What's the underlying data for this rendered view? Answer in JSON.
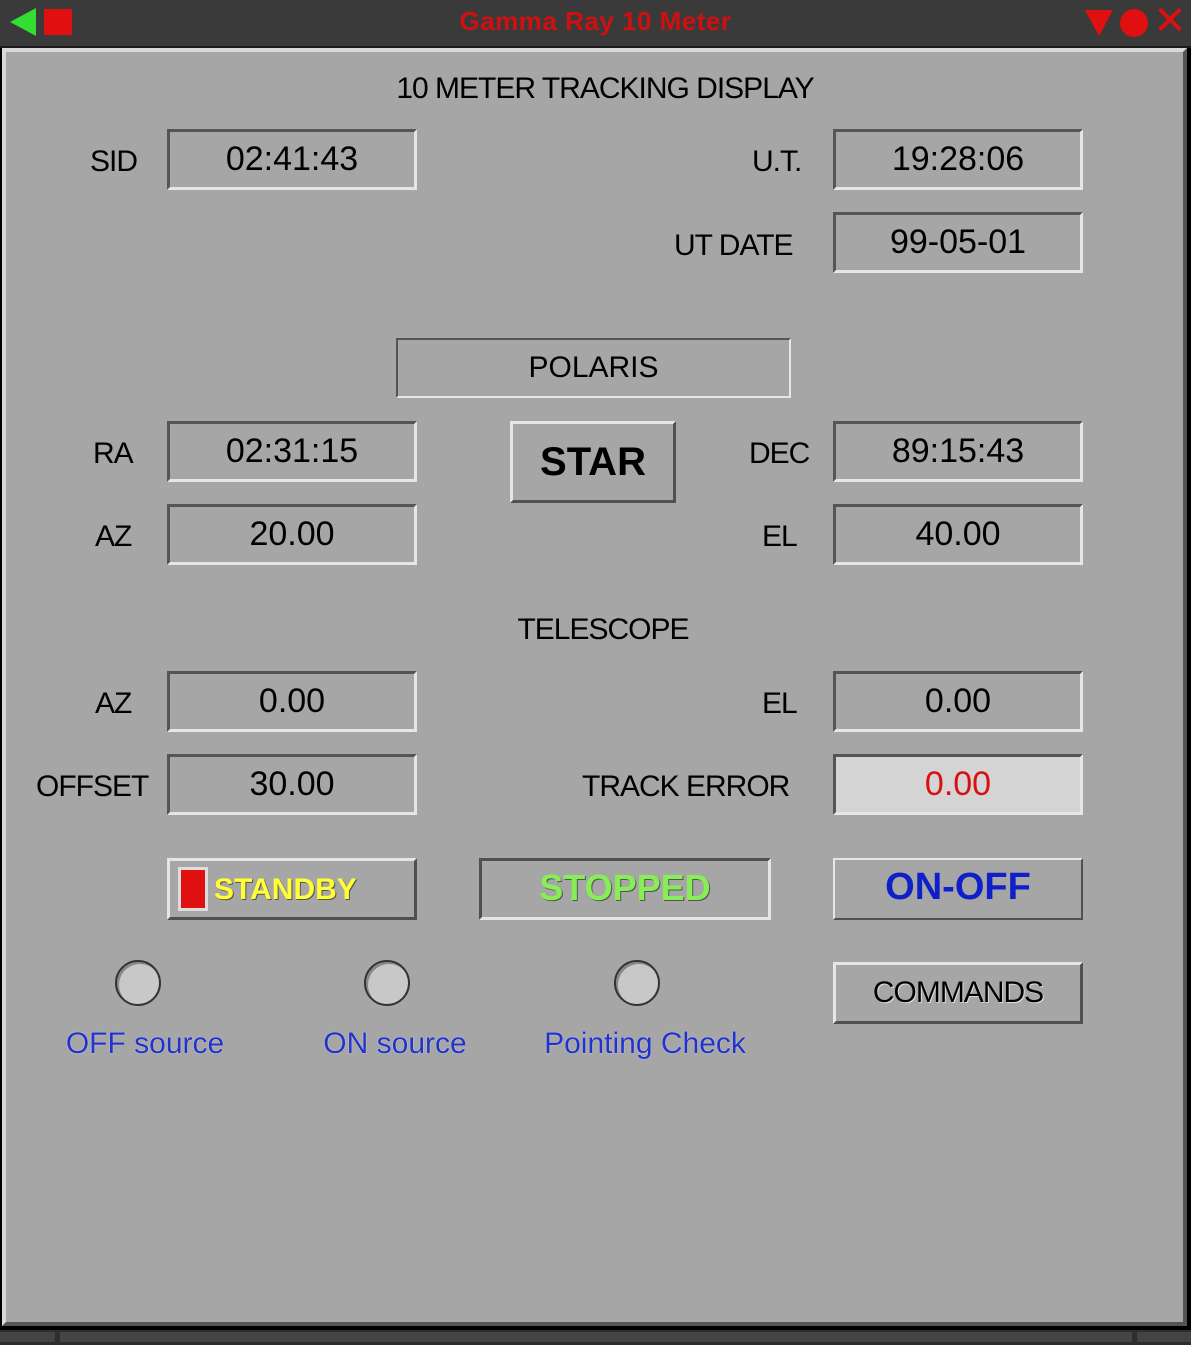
{
  "window": {
    "title": "Gamma Ray 10 Meter"
  },
  "display": {
    "heading": "10 METER TRACKING DISPLAY",
    "sid_label": "SID",
    "sid_value": "02:41:43",
    "ut_label": "U.T.",
    "ut_value": "19:28:06",
    "utdate_label": "UT DATE",
    "utdate_value": "99-05-01"
  },
  "source": {
    "name": "POLARIS",
    "type_button": "STAR",
    "ra_label": "RA",
    "ra_value": "02:31:15",
    "dec_label": "DEC",
    "dec_value": "89:15:43",
    "az_label": "AZ",
    "az_value": "20.00",
    "el_label": "EL",
    "el_value": "40.00"
  },
  "telescope": {
    "heading": "TELESCOPE",
    "az_label": "AZ",
    "az_value": "0.00",
    "el_label": "EL",
    "el_value": "0.00",
    "offset_label": "OFFSET",
    "offset_value": "30.00",
    "track_error_label": "TRACK ERROR",
    "track_error_value": "0.00"
  },
  "controls": {
    "standby_label": "STANDBY",
    "stopped_label": "STOPPED",
    "onoff_label": "ON-OFF",
    "commands_label": "COMMANDS"
  },
  "modes": [
    {
      "label": "OFF source"
    },
    {
      "label": "ON source"
    },
    {
      "label": "Pointing Check"
    }
  ],
  "colors": {
    "title": "#d01010",
    "panel": "#a6a6a6",
    "track_error": "#d81010",
    "standby_text": "#ffff33",
    "stopped_text": "#88ee55",
    "onoff_text": "#1020c8",
    "mode_text": "#2233cc"
  }
}
